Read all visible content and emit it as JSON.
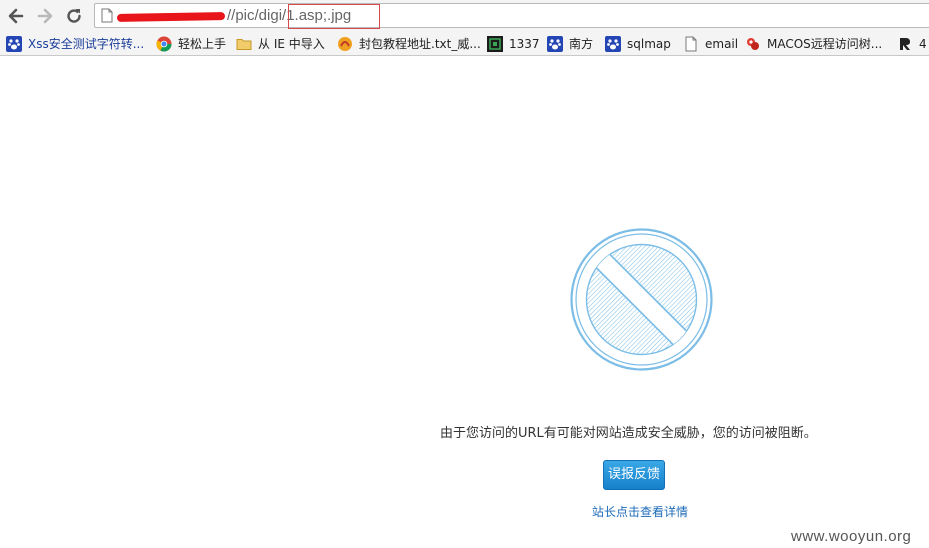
{
  "browser": {
    "address_bar": {
      "url_visible": "//pic/digi/1.asp;.jpg"
    },
    "bookmarks": [
      {
        "label": "Xss安全测试字符转...",
        "icon": "paw-icon"
      },
      {
        "label": "轻松上手",
        "icon": "chrome-icon"
      },
      {
        "label": "从 IE 中导入",
        "icon": "folder-icon"
      },
      {
        "label": "封包教程地址.txt_威...",
        "icon": "site-favicon-icon"
      },
      {
        "label": "1337",
        "icon": "site-favicon-icon"
      },
      {
        "label": "南方",
        "icon": "paw-icon"
      },
      {
        "label": "sqlmap",
        "icon": "paw-icon"
      },
      {
        "label": "email",
        "icon": "page-icon"
      },
      {
        "label": "MACOS远程访问树...",
        "icon": "site-favicon-icon"
      },
      {
        "label": "4",
        "icon": "site-favicon-icon"
      }
    ]
  },
  "block_page": {
    "message": "由于您访问的URL有可能对网站造成安全威胁，您的访问被阻断。",
    "report_button": "误报反馈",
    "details_link": "站长点击查看详情"
  },
  "watermark": "www.wooyun.org",
  "colors": {
    "accent_blue": "#1a86d0",
    "stop_icon_blue": "#7bbde6",
    "highlight_red": "#d8494a"
  }
}
